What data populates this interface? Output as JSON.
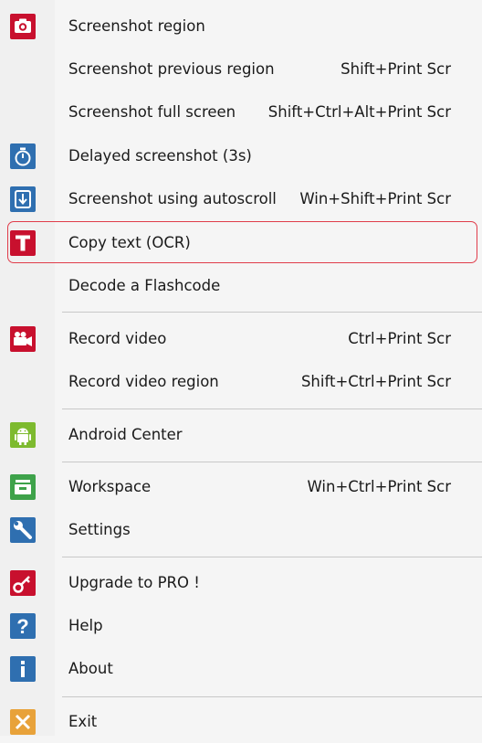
{
  "menu": {
    "items": [
      {
        "label": "Screenshot region",
        "shortcut": "",
        "icon": "camera-icon"
      },
      {
        "label": "Screenshot previous region",
        "shortcut": "Shift+Print Scr",
        "icon": ""
      },
      {
        "label": "Screenshot full screen",
        "shortcut": "Shift+Ctrl+Alt+Print Scr",
        "icon": ""
      },
      {
        "label": "Delayed screenshot (3s)",
        "shortcut": "",
        "icon": "timer-icon"
      },
      {
        "label": "Screenshot using autoscroll",
        "shortcut": "Win+Shift+Print Scr",
        "icon": "autoscroll-icon"
      },
      {
        "label": "Copy text (OCR)",
        "shortcut": "",
        "icon": "text-t-icon"
      },
      {
        "label": "Decode a Flashcode",
        "shortcut": "",
        "icon": ""
      },
      {
        "label": "Record video",
        "shortcut": "Ctrl+Print Scr",
        "icon": "video-camera-icon"
      },
      {
        "label": "Record video region",
        "shortcut": "Shift+Ctrl+Print Scr",
        "icon": ""
      },
      {
        "label": "Android Center",
        "shortcut": "",
        "icon": "android-icon"
      },
      {
        "label": "Workspace",
        "shortcut": "Win+Ctrl+Print Scr",
        "icon": "workspace-icon"
      },
      {
        "label": "Settings",
        "shortcut": "",
        "icon": "wrench-icon"
      },
      {
        "label": "Upgrade to PRO !",
        "shortcut": "",
        "icon": "key-icon"
      },
      {
        "label": "Help",
        "shortcut": "",
        "icon": "question-icon"
      },
      {
        "label": "About",
        "shortcut": "",
        "icon": "info-icon"
      },
      {
        "label": "Exit",
        "shortcut": "",
        "icon": "close-icon"
      }
    ],
    "highlighted_item": "Copy text (OCR)"
  },
  "colors": {
    "red": "#c8102e",
    "blue": "#2f6fb0",
    "green": "#7dba2f",
    "workspace_green": "#3ea24a",
    "exit_orange": "#e8a23a",
    "highlight_border": "#e03c4a"
  }
}
